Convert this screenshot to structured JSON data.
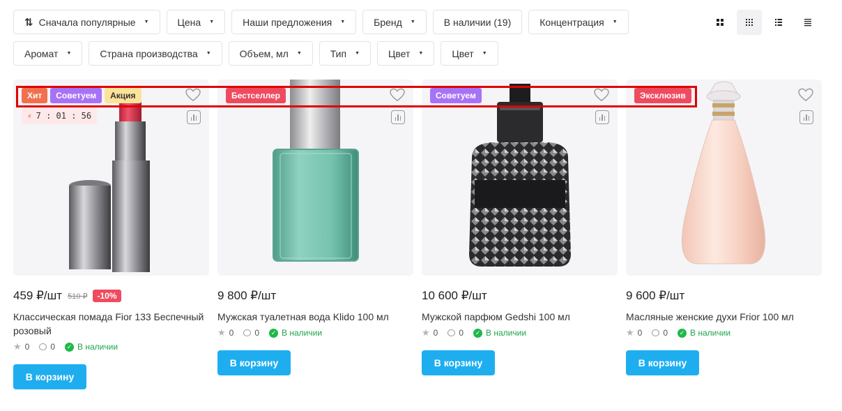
{
  "filters": {
    "row1": [
      {
        "label": "Сначала популярные",
        "icon": "sort-icon"
      },
      {
        "label": "Цена"
      },
      {
        "label": "Наши предложения"
      },
      {
        "label": "Бренд"
      },
      {
        "label": "В наличии (19)",
        "no_caret": true
      },
      {
        "label": "Концентрация"
      }
    ],
    "row2": [
      {
        "label": "Аромат"
      },
      {
        "label": "Страна производства"
      },
      {
        "label": "Объем, мл"
      },
      {
        "label": "Тип"
      },
      {
        "label": "Цвет"
      },
      {
        "label": "Цвет"
      }
    ]
  },
  "view_modes": [
    "grid-large-icon",
    "grid-small-icon",
    "list-icon",
    "table-icon"
  ],
  "colors": {
    "accent": "#1eaef0",
    "badge_hit": "#f2704d",
    "badge_recommend": "#a773f6",
    "badge_sale": "#fbe49a",
    "badge_bestseller": "#ef4b5f",
    "badge_exclusive": "#ef4b5f",
    "in_stock": "#1fb848",
    "highlight": "#e00000"
  },
  "products": [
    {
      "badges": [
        {
          "label": "Хит",
          "color": "#f2704d",
          "text": "#fff"
        },
        {
          "label": "Советуем",
          "color": "#a773f6",
          "text": "#fff"
        },
        {
          "label": "Акция",
          "color": "#fbe49a",
          "text": "#333"
        }
      ],
      "timer": "7 : 01 : 56",
      "price": "459 ₽/шт",
      "old_price": "510 ₽",
      "discount": "-10%",
      "title": "Классическая помада Fior 133 Беспечный розовый",
      "rating": "0",
      "reviews": "0",
      "stock": "В наличии",
      "cart": "В корзину",
      "image": "lipstick"
    },
    {
      "badges": [
        {
          "label": "Бестселлер",
          "color": "#ef4b5f",
          "text": "#fff"
        }
      ],
      "price": "9 800 ₽/шт",
      "title": "Мужская туалетная вода Klido 100 мл",
      "rating": "0",
      "reviews": "0",
      "stock": "В наличии",
      "cart": "В корзину",
      "image": "green-bottle"
    },
    {
      "badges": [
        {
          "label": "Советуем",
          "color": "#a773f6",
          "text": "#fff"
        }
      ],
      "price": "10 600 ₽/шт",
      "title": "Мужской парфюм Gedshi 100 мл",
      "rating": "0",
      "reviews": "0",
      "stock": "В наличии",
      "cart": "В корзину",
      "image": "studded-bottle"
    },
    {
      "badges": [
        {
          "label": "Эксклюзив",
          "color": "#ef4b5f",
          "text": "#fff"
        }
      ],
      "price": "9 600 ₽/шт",
      "title": "Масляные женские духи Frior 100 мл",
      "rating": "0",
      "reviews": "0",
      "stock": "В наличии",
      "cart": "В корзину",
      "image": "pink-bottle"
    }
  ]
}
